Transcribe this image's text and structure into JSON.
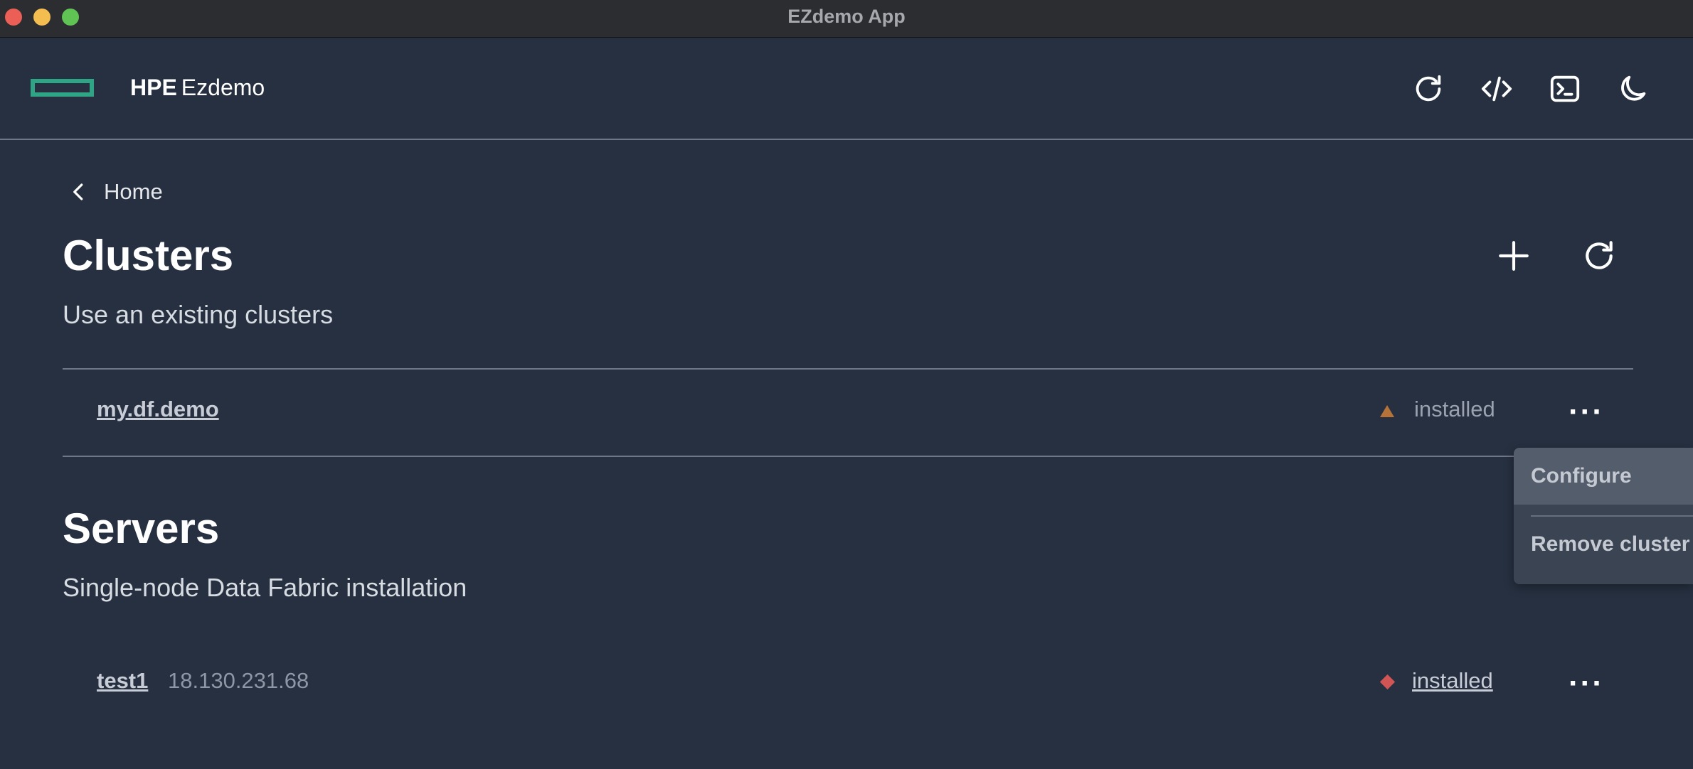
{
  "window": {
    "title": "EZdemo App"
  },
  "header": {
    "brand_strong": "HPE",
    "brand_light": "Ezdemo",
    "actions": [
      {
        "name": "refresh",
        "icon": "refresh-icon"
      },
      {
        "name": "code",
        "icon": "code-icon"
      },
      {
        "name": "terminal",
        "icon": "terminal-icon"
      },
      {
        "name": "theme",
        "icon": "moon-icon"
      }
    ]
  },
  "nav": {
    "back_label": "Home"
  },
  "clusters": {
    "title": "Clusters",
    "subtitle": "Use an existing clusters",
    "items": [
      {
        "name": "my.df.demo",
        "status": "installed",
        "status_color": "#b5733a",
        "status_icon": "triangle-icon"
      }
    ]
  },
  "servers": {
    "title": "Servers",
    "subtitle": "Single-node Data Fabric installation",
    "items": [
      {
        "name": "test1",
        "ip": "18.130.231.68",
        "status": "installed",
        "status_color": "#d25555",
        "status_icon": "diamond-icon"
      }
    ]
  },
  "menu": {
    "items": [
      {
        "label": "Configure",
        "active": true
      },
      {
        "label": "Remove cluster",
        "active": false
      }
    ]
  },
  "colors": {
    "background": "#263040",
    "accent": "#2fa586",
    "divider": "#6f7787"
  }
}
